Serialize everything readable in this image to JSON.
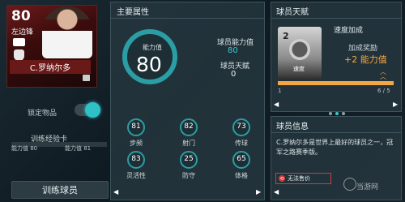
{
  "player_card": {
    "rating": "80",
    "position": "左边锋",
    "name": "C.罗纳尔多"
  },
  "lock": {
    "label": "锁定物品",
    "locked": true
  },
  "training": {
    "card_label": "训练经验卡",
    "current_label": "能力值 80",
    "next_label": "能力值 81",
    "progress": 0.0,
    "button_label": "训练球员"
  },
  "main_attributes": {
    "title": "主要属性",
    "ability_label": "能力值",
    "ability_value": "80",
    "player_ability_label": "球员能力值",
    "player_ability_value": "80",
    "player_talent_label": "球员天赋",
    "player_talent_value": "0",
    "stats": [
      {
        "value": "81",
        "label": "步频"
      },
      {
        "value": "82",
        "label": "射门"
      },
      {
        "value": "73",
        "label": "传球"
      },
      {
        "value": "83",
        "label": "灵活性"
      },
      {
        "value": "25",
        "label": "防守"
      },
      {
        "value": "65",
        "label": "体格"
      }
    ]
  },
  "talent": {
    "title": "球员天赋",
    "card_rank": "2",
    "card_name": "速度",
    "name": "速度加成",
    "bonus_label": "加成奖励",
    "bonus_value": "+2 能力值",
    "progress_start": "1",
    "progress_count": "6 / 5",
    "progress": 1.0
  },
  "info": {
    "title": "球员信息",
    "description": "C.罗纳尔多是世界上最好的球员之一，冠军之路赛季版。",
    "history_button_label": "无法售价"
  },
  "nav": {
    "left_arrow": "◀",
    "right_arrow": "▶"
  },
  "watermark": "当游网"
}
